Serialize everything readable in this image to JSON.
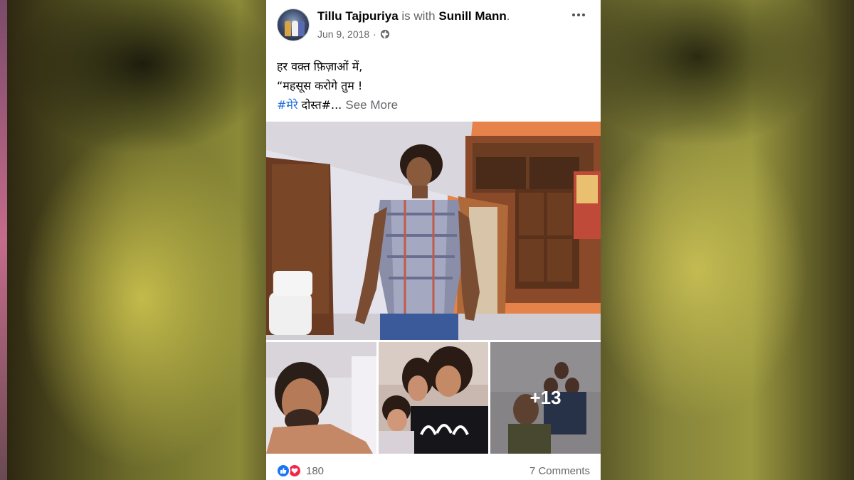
{
  "post": {
    "author": "Tillu Tajpuriya",
    "with_text": "is with",
    "tagged": "Sunill Mann",
    "period": ".",
    "date": "Jun 9, 2018",
    "separator": "·",
    "privacy_icon": "globe-icon",
    "menu_icon": "more-options-icon",
    "caption": {
      "line1": "हर वक़्त फ़िज़ाओं में,",
      "line2": "“महसूस करोगे तुम !",
      "hashtag": "#मेरे",
      "line3_rest": " दोस्त#...",
      "see_more": "See More"
    },
    "photos": {
      "extra_count": "+13"
    },
    "footer": {
      "reaction_icons": [
        "like-icon",
        "love-icon"
      ],
      "reaction_count": "180",
      "comments": "7 Comments"
    }
  },
  "colors": {
    "link_blue": "#216fdb",
    "meta_gray": "#65676b",
    "like_blue": "#1877f2",
    "love_red": "#f02849"
  }
}
